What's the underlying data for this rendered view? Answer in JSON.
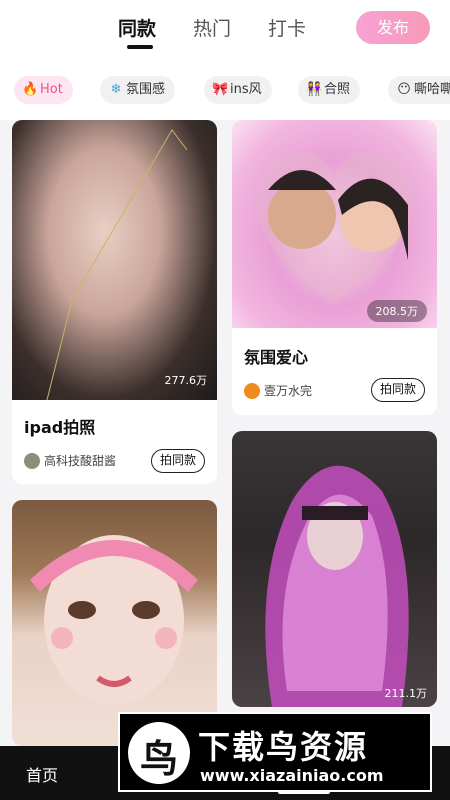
{
  "header": {
    "tabs": [
      {
        "label": "同款",
        "active": true
      },
      {
        "label": "热门",
        "active": false
      },
      {
        "label": "打卡",
        "active": false
      }
    ],
    "publish_label": "发布"
  },
  "chips": [
    {
      "icon": "flame-icon",
      "glyph": "🔥",
      "label": "Hot",
      "active": true
    },
    {
      "icon": "snowflake-icon",
      "glyph": "❄",
      "label": "氛围感",
      "active": false
    },
    {
      "icon": "bow-icon",
      "glyph": "🎀",
      "label": "ins风",
      "active": false
    },
    {
      "icon": "couple-icon",
      "glyph": "👭",
      "label": "合照",
      "active": false
    },
    {
      "icon": "face-icon",
      "glyph": "😶",
      "label": "嘶哈嘶",
      "active": false
    }
  ],
  "feed": [
    {
      "views": "277.6万",
      "title": "ipad拍照",
      "author": "高科技酸甜酱",
      "action": "拍同款"
    },
    {
      "views": "208.5万",
      "title": "氛围爱心",
      "author": "壹万水完",
      "action": "拍同款"
    },
    {
      "views": "",
      "title": "",
      "author": "",
      "action": ""
    },
    {
      "views": "211.1万",
      "title": "",
      "author": "",
      "action": ""
    }
  ],
  "bottom_nav": {
    "home_label": "首页"
  },
  "watermark": {
    "logo_glyph": "鸟",
    "title": "下载鸟资源",
    "url": "www.xiazainiao.com"
  },
  "colors": {
    "accent": "#ef4f8f",
    "publish_gradient_start": "#f7a2d5",
    "publish_gradient_end": "#f79ab5"
  }
}
